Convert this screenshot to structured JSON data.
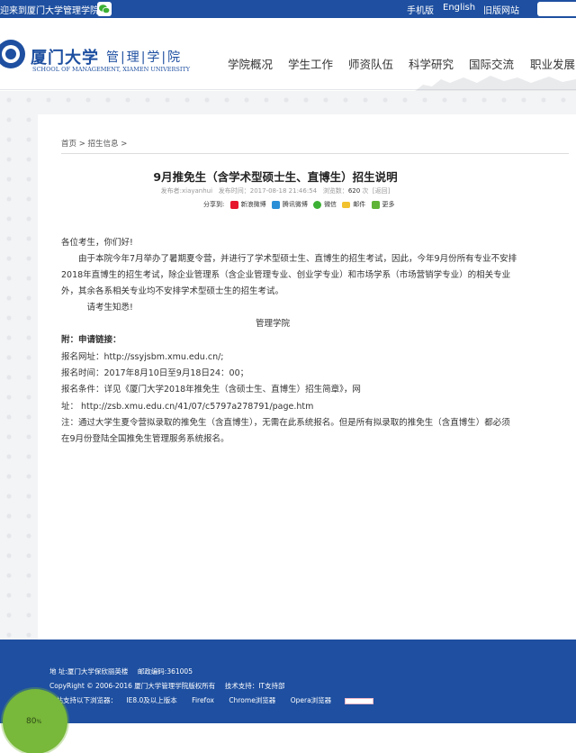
{
  "topbar": {
    "welcome": "迎来到厦门大学管理学院!",
    "links": {
      "mobile": "手机版",
      "english": "English",
      "old_site": "旧版网站"
    }
  },
  "header": {
    "logo_cn": "厦门大学",
    "logo_sub": "管|理|学|院",
    "logo_en": "SCHOOL OF MANAGEMENT, XIAMEN UNIVERSITY",
    "nav": [
      "学院概况",
      "学生工作",
      "师资队伍",
      "科学研究",
      "国际交流",
      "职业发展"
    ]
  },
  "breadcrumb": {
    "home": "首页",
    "sep1": ">",
    "section": "招生信息",
    "sep2": ">"
  },
  "article": {
    "title": "9月推免生（含学术型硕士生、直博生）招生说明",
    "meta": {
      "publisher_label": "发布者:",
      "publisher": "xiayanhui",
      "time_label": "发布时间：",
      "time": "2017-08-18 21:46:54",
      "views_label": "浏览数：",
      "views": "620",
      "views_unit": "次",
      "back": "[返回]"
    },
    "share": {
      "label": "分享到:",
      "items": [
        "新浪微博",
        "腾讯微博",
        "微信",
        "邮件",
        "更多"
      ]
    },
    "lines": [
      "各位考生，你们好!",
      "　　由于本院今年7月举办了暑期夏令营，并进行了学术型硕士生、直博生的招生考试，因此，今年9月份所有专业不安排",
      "2018年直博生的招生考试，除企业管理系（含企业管理专业、创业学专业）和市场学系（市场营销学专业）的相关专业",
      "外，其余各系相关专业均不安排学术型硕士生的招生考试。",
      "　　　请考生知悉!",
      "管理学院",
      "附：申请链接：",
      "报名网址：http://ssyjsbm.xmu.edu.cn/;",
      "报名时间：2017年8月10日至9月18日24：00；",
      "报名条件：详见《厦门大学2018年推免生（含硕士生、直博生）招生简章》，网",
      "址：  http://zsb.xmu.edu.cn/41/07/c5797a278791/page.htm",
      "注：通过大学生夏令营拟录取的推免生（含直博生），无需在此系统报名。但是所有拟录取的推免生（含直博生）都必须",
      "在9月份登陆全国推免生管理服务系统报名。"
    ]
  },
  "footer": {
    "address": "地 址:厦门大学保欣丽英楼",
    "postcode": "邮政编码:361005",
    "copyright": "CopyRight © 2006-2016 厦门大学管理学院版权所有",
    "support": "技术支持：IT支持部",
    "browsers_label": "本站支持以下浏览器：",
    "browsers": [
      "IE8.0及以上版本",
      "Firefox",
      "Chrome浏览器",
      "Opera浏览器"
    ]
  },
  "bubble": {
    "value": "80",
    "unit": "%"
  },
  "colors": {
    "brand_blue": "#1e4fa0",
    "bubble_green": "#78b83a"
  }
}
